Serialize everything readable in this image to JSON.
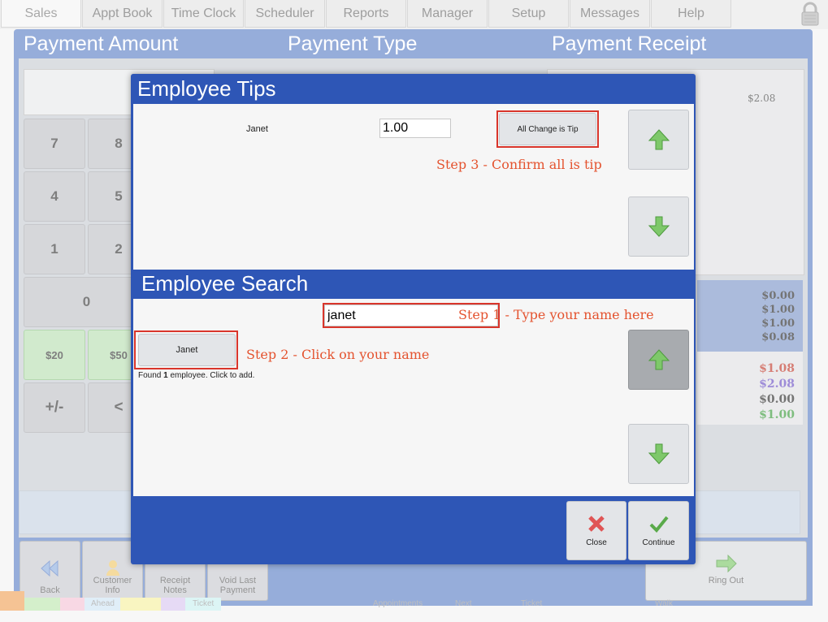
{
  "tabs": [
    {
      "label": "Sales",
      "active": true
    },
    {
      "label": "Appt Book"
    },
    {
      "label": "Time Clock"
    },
    {
      "label": "Scheduler"
    },
    {
      "label": "Reports"
    },
    {
      "label": "Manager"
    },
    {
      "label": "Setup"
    },
    {
      "label": "Messages"
    },
    {
      "label": "Help"
    }
  ],
  "headers": {
    "amount": "Payment Amount",
    "type": "Payment Type",
    "receipt": "Payment Receipt"
  },
  "keypad": {
    "k7": "7",
    "k8": "8",
    "k4": "4",
    "k5": "5",
    "k1": "1",
    "k2": "2",
    "k0": "0",
    "k20": "$20",
    "k50": "$50",
    "plusminus": "+/-",
    "back": "<"
  },
  "receipt": {
    "amount": "$2.08"
  },
  "totals": {
    "blue": [
      "$0.00",
      "$1.00",
      "$1.00",
      "$0.08"
    ],
    "colored": [
      {
        "value": "$1.08",
        "color": "#c0392b"
      },
      {
        "value": "$2.08",
        "color": "#6a4fc4"
      },
      {
        "value": "$0.00",
        "color": "#2a2a2a"
      },
      {
        "value": "$1.00",
        "color": "#3a9a3a"
      }
    ]
  },
  "bottom": {
    "back": "Back",
    "customer_info": "Customer Info",
    "receipt_notes": "Receipt Notes",
    "void_last": "Void Last Payment",
    "ring_out": "Ring Out",
    "ghost": {
      "appointments": "Appointments",
      "next": "Next",
      "ticket": "Ticket",
      "walk": "Walk",
      "ahead": "Ahead",
      "ticket2": "Ticket"
    }
  },
  "dialog": {
    "title": "Employee Tips",
    "tip_employee": "Janet",
    "tip_amount": "1.00",
    "all_change_label": "All Change is Tip",
    "step3": "Step 3 - Confirm all is tip",
    "search_title": "Employee Search",
    "search_value": "janet",
    "step1": "Step 1 - Type your name here",
    "result_name": "Janet",
    "step2": "Step 2 - Click on your name",
    "found_prefix": "Found ",
    "found_count": "1",
    "found_suffix": " employee. Click to add.",
    "close": "Close",
    "continue": "Continue"
  },
  "colors": {
    "accent_blue": "#2e56b6",
    "annotation": "#e4532f",
    "up_arrow": "green-up-arrow-icon",
    "down_arrow": "green-down-arrow-icon"
  }
}
